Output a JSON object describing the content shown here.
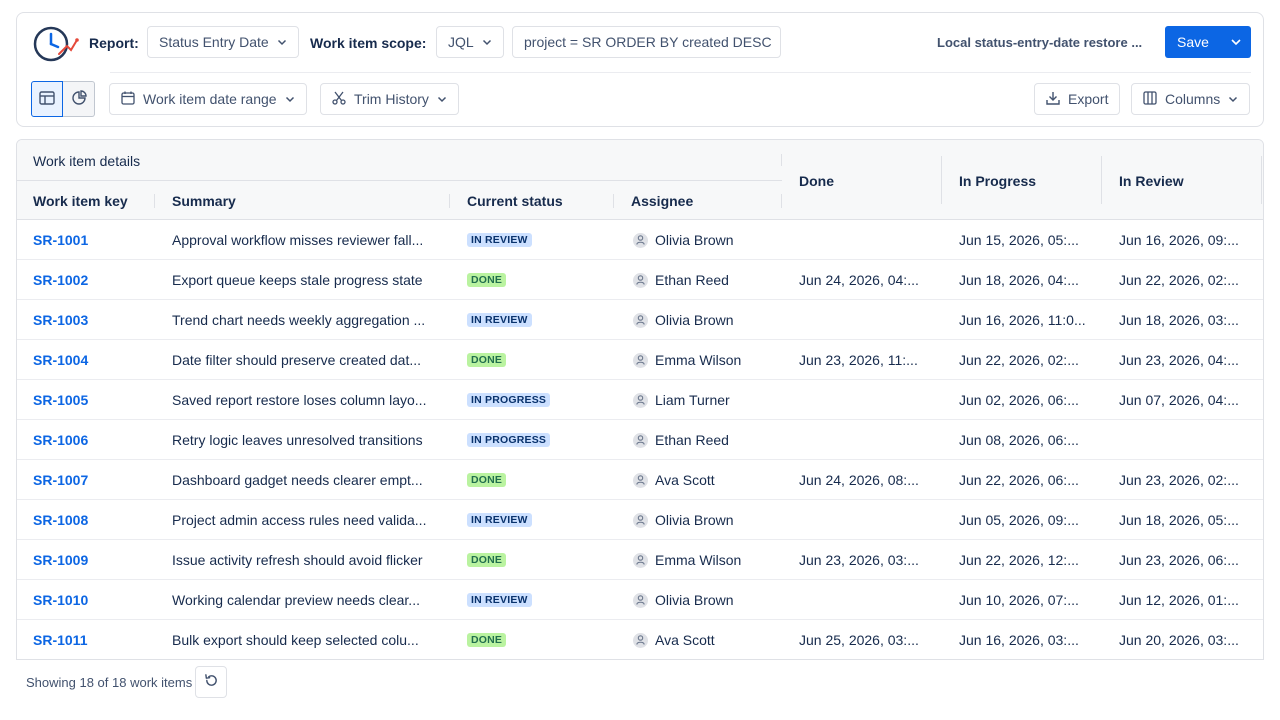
{
  "toolbar": {
    "report_label": "Report:",
    "report_value": "Status Entry Date",
    "scope_label": "Work item scope:",
    "scope_type": "JQL",
    "jql_query": "project = SR ORDER BY created DESC",
    "saved_report_name": "Local status-entry-date restore ...",
    "save_label": "Save",
    "date_range_label": "Work item date range",
    "trim_history_label": "Trim History",
    "export_label": "Export",
    "columns_label": "Columns",
    "active_view": "table",
    "accent_color": "#0c66e4"
  },
  "table": {
    "group_header": "Work item details",
    "columns": {
      "key": "Work item key",
      "summary": "Summary",
      "status": "Current status",
      "assignee": "Assignee",
      "done": "Done",
      "in_progress": "In Progress",
      "in_review": "In Review"
    },
    "status_colors": {
      "IN REVIEW": {
        "bg": "#cce0ff",
        "fg": "#09326c"
      },
      "DONE": {
        "bg": "#baf3a0",
        "fg": "#216e4e"
      },
      "IN PROGRESS": {
        "bg": "#cce0ff",
        "fg": "#09326c"
      }
    },
    "rows": [
      {
        "key": "SR-1001",
        "summary": "Approval workflow misses reviewer fall...",
        "status": "IN REVIEW",
        "assignee": "Olivia Brown",
        "done": "",
        "in_progress": "Jun 15, 2026, 05:...",
        "in_review": "Jun 16, 2026, 09:..."
      },
      {
        "key": "SR-1002",
        "summary": "Export queue keeps stale progress state",
        "status": "DONE",
        "assignee": "Ethan Reed",
        "done": "Jun 24, 2026, 04:...",
        "in_progress": "Jun 18, 2026, 04:...",
        "in_review": "Jun 22, 2026, 02:..."
      },
      {
        "key": "SR-1003",
        "summary": "Trend chart needs weekly aggregation ...",
        "status": "IN REVIEW",
        "assignee": "Olivia Brown",
        "done": "",
        "in_progress": "Jun 16, 2026, 11:0...",
        "in_review": "Jun 18, 2026, 03:..."
      },
      {
        "key": "SR-1004",
        "summary": "Date filter should preserve created dat...",
        "status": "DONE",
        "assignee": "Emma Wilson",
        "done": "Jun 23, 2026, 11:...",
        "in_progress": "Jun 22, 2026, 02:...",
        "in_review": "Jun 23, 2026, 04:..."
      },
      {
        "key": "SR-1005",
        "summary": "Saved report restore loses column layo...",
        "status": "IN PROGRESS",
        "assignee": "Liam Turner",
        "done": "",
        "in_progress": "Jun 02, 2026, 06:...",
        "in_review": "Jun 07, 2026, 04:..."
      },
      {
        "key": "SR-1006",
        "summary": "Retry logic leaves unresolved transitions",
        "status": "IN PROGRESS",
        "assignee": "Ethan Reed",
        "done": "",
        "in_progress": "Jun 08, 2026, 06:...",
        "in_review": ""
      },
      {
        "key": "SR-1007",
        "summary": "Dashboard gadget needs clearer empt...",
        "status": "DONE",
        "assignee": "Ava Scott",
        "done": "Jun 24, 2026, 08:...",
        "in_progress": "Jun 22, 2026, 06:...",
        "in_review": "Jun 23, 2026, 02:..."
      },
      {
        "key": "SR-1008",
        "summary": "Project admin access rules need valida...",
        "status": "IN REVIEW",
        "assignee": "Olivia Brown",
        "done": "",
        "in_progress": "Jun 05, 2026, 09:...",
        "in_review": "Jun 18, 2026, 05:..."
      },
      {
        "key": "SR-1009",
        "summary": "Issue activity refresh should avoid flicker",
        "status": "DONE",
        "assignee": "Emma Wilson",
        "done": "Jun 23, 2026, 03:...",
        "in_progress": "Jun 22, 2026, 12:...",
        "in_review": "Jun 23, 2026, 06:..."
      },
      {
        "key": "SR-1010",
        "summary": "Working calendar preview needs clear...",
        "status": "IN REVIEW",
        "assignee": "Olivia Brown",
        "done": "",
        "in_progress": "Jun 10, 2026, 07:...",
        "in_review": "Jun 12, 2026, 01:..."
      },
      {
        "key": "SR-1011",
        "summary": "Bulk export should keep selected colu...",
        "status": "DONE",
        "assignee": "Ava Scott",
        "done": "Jun 25, 2026, 03:...",
        "in_progress": "Jun 16, 2026, 03:...",
        "in_review": "Jun 20, 2026, 03:..."
      }
    ]
  },
  "footer": {
    "count_text": "Showing 18 of 18 work items"
  }
}
